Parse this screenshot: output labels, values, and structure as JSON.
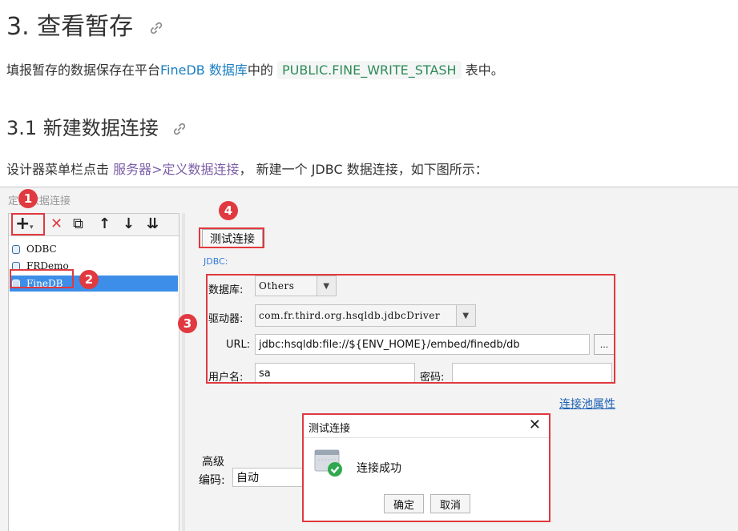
{
  "doc": {
    "h1": "3. 查看暂存",
    "h2": "3.1 新建数据连接",
    "p1": {
      "before": "填报暂存的数据保存在平台",
      "link1": "FineDB",
      "link2": "数据库",
      "mid": "中的",
      "code": "PUBLIC.FINE_WRITE_STASH",
      "after": "表中。"
    },
    "p2": {
      "before": "设计器菜单栏点击",
      "link": "服务器>定义数据连接",
      "after": "， 新建一个 JDBC 数据连接，如下图所示："
    }
  },
  "window": {
    "title": "定义数据连接",
    "toolbar": {
      "add": "+",
      "delete": "✕",
      "copy": "⧉",
      "up": "↑",
      "down": "↓",
      "sort": "⇊"
    },
    "tree": [
      "ODBC",
      "FRDemo",
      "FineDB"
    ],
    "test_button": "测试连接",
    "jdbc_group": "JDBC:",
    "database_label": "数据库:",
    "database_value": "Others",
    "driver_label": "驱动器:",
    "driver_value": "com.fr.third.org.hsqldb.jdbcDriver",
    "url_label": "URL:",
    "url_value": "jdbc:hsqldb:file://${ENV_HOME}/embed/finedb/db",
    "url_more": "...",
    "user_label": "用户名:",
    "user_value": "sa",
    "password_label": "密码:",
    "password_value": "",
    "pool_link": "连接池属性",
    "advanced_label": "高级",
    "encoding_label": "编码:",
    "encoding_value": "自动"
  },
  "badges": [
    "1",
    "2",
    "3",
    "4"
  ],
  "dialog": {
    "title": "测试连接",
    "close": "✕",
    "message": "连接成功",
    "ok": "确定",
    "cancel": "取消"
  },
  "colors": {
    "accent_red": "#e0393f",
    "link_blue": "#1a7ec2",
    "code_green": "#2e8b57",
    "selection": "#3d8ee8"
  }
}
